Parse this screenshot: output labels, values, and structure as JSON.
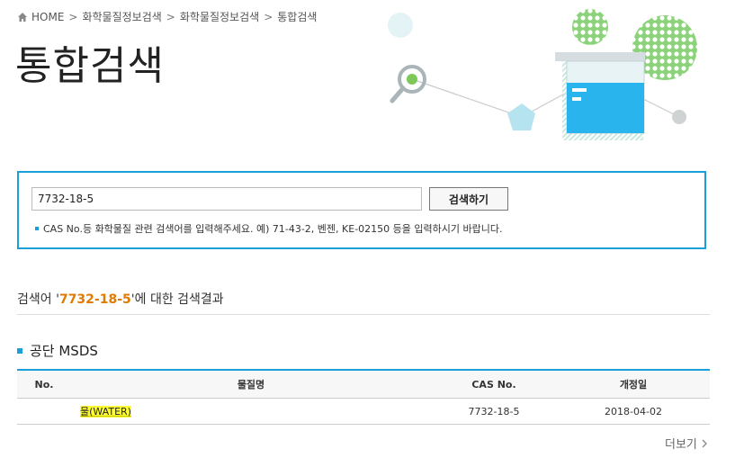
{
  "breadcrumb": {
    "items": [
      "HOME",
      "화학물질정보검색",
      "화학물질정보검색",
      "통합검색"
    ],
    "separator": ">"
  },
  "page": {
    "title": "통합검색"
  },
  "search": {
    "value": "7732-18-5",
    "button_label": "검색하기",
    "hint": "CAS No.등 화학물질 관련 검색어를 입력해주세요. 예) 71-43-2, 벤젠, KE-02150 등을 입력하시기 바랍니다."
  },
  "result": {
    "prefix": "검색어 '",
    "keyword": "7732-18-5",
    "suffix": "'에 대한 검색결과"
  },
  "section": {
    "title": "공단 MSDS"
  },
  "table": {
    "columns": [
      "No.",
      "물질명",
      "CAS No.",
      "개정일"
    ],
    "rows": [
      {
        "no": "",
        "name": "물(WATER)",
        "cas": "7732-18-5",
        "date": "2018-04-02"
      }
    ]
  },
  "more": {
    "label": "더보기"
  },
  "colors": {
    "accent": "#1a9fd9",
    "keyword": "#e07a00",
    "highlight": "#ffff33"
  },
  "icons": {
    "home": "home-icon",
    "more": "chevron-right-icon"
  }
}
